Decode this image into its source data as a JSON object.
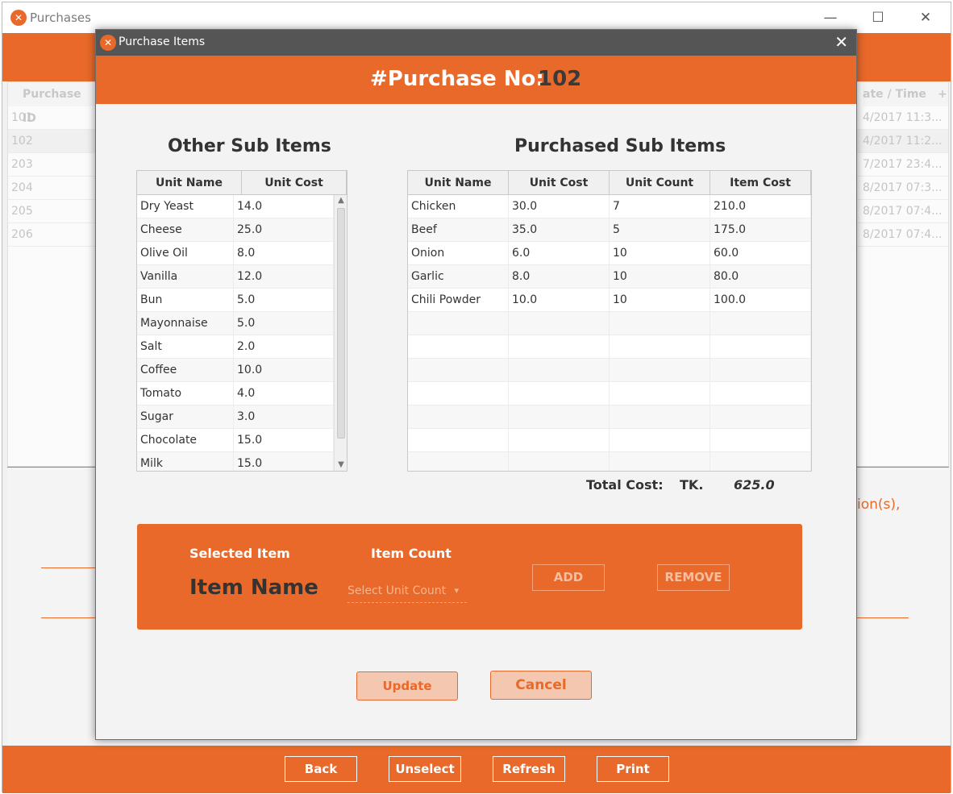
{
  "bg_window": {
    "title": "Purchases",
    "table_headers": {
      "purchase_id": "Purchase ID",
      "date_time": "ate / Time",
      "plus": "+"
    },
    "rows": [
      {
        "id": "101",
        "date": "4/2017 11:3..."
      },
      {
        "id": "102",
        "date": "4/2017 11:2..."
      },
      {
        "id": "203",
        "date": "7/2017 23:4..."
      },
      {
        "id": "204",
        "date": "8/2017 07:3..."
      },
      {
        "id": "205",
        "date": "8/2017 07:4..."
      },
      {
        "id": "206",
        "date": "8/2017 07:4..."
      }
    ],
    "side_text": "ion(s),",
    "footer_buttons": {
      "back": "Back",
      "unselect": "Unselect",
      "refresh": "Refresh",
      "print": "Print"
    }
  },
  "dialog": {
    "title": "Purchase Items",
    "close": "✕",
    "header_label": "#Purchase No:",
    "purchase_no": "102",
    "other_title": "Other Sub Items",
    "purchased_title": "Purchased Sub Items",
    "other_headers": {
      "unit_name": "Unit Name",
      "unit_cost": "Unit Cost"
    },
    "purchased_headers": {
      "unit_name": "Unit Name",
      "unit_cost": "Unit Cost",
      "unit_count": "Unit Count",
      "item_cost": "Item Cost"
    },
    "other_items": [
      {
        "name": "Dry Yeast",
        "cost": "14.0"
      },
      {
        "name": "Cheese",
        "cost": "25.0"
      },
      {
        "name": "Olive Oil",
        "cost": "8.0"
      },
      {
        "name": "Vanilla",
        "cost": "12.0"
      },
      {
        "name": "Bun",
        "cost": "5.0"
      },
      {
        "name": "Mayonnaise",
        "cost": "5.0"
      },
      {
        "name": "Salt",
        "cost": "2.0"
      },
      {
        "name": "Coffee",
        "cost": "10.0"
      },
      {
        "name": "Tomato",
        "cost": "4.0"
      },
      {
        "name": "Sugar",
        "cost": "3.0"
      },
      {
        "name": "Chocolate",
        "cost": "15.0"
      },
      {
        "name": "Milk",
        "cost": "15.0"
      }
    ],
    "purchased_items": [
      {
        "name": "Chicken",
        "unit_cost": "30.0",
        "count": "7",
        "item_cost": "210.0"
      },
      {
        "name": "Beef",
        "unit_cost": "35.0",
        "count": "5",
        "item_cost": "175.0"
      },
      {
        "name": "Onion",
        "unit_cost": "6.0",
        "count": "10",
        "item_cost": "60.0"
      },
      {
        "name": "Garlic",
        "unit_cost": "8.0",
        "count": "10",
        "item_cost": "80.0"
      },
      {
        "name": "Chili Powder",
        "unit_cost": "10.0",
        "count": "10",
        "item_cost": "100.0"
      }
    ],
    "total_label": "Total Cost:",
    "currency": "TK.",
    "total_value": "625.0",
    "selected_item_label": "Selected Item",
    "item_count_label": "Item Count",
    "item_name": "Item Name",
    "select_unit_count": "Select Unit Count",
    "add": "ADD",
    "remove": "REMOVE",
    "update": "Update",
    "cancel": "Cancel"
  },
  "colors": {
    "accent": "#e8692a",
    "dialog_titlebar": "#555555"
  },
  "icons": {
    "app": "fork-knife-icon"
  }
}
